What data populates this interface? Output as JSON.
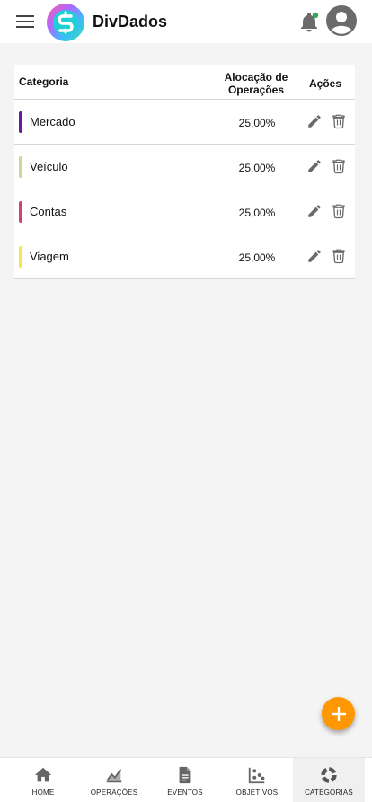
{
  "app": {
    "title": "DivDados"
  },
  "header": {
    "menu_icon": "menu-icon",
    "bell_icon": "notifications-icon",
    "account_icon": "account-circle-icon",
    "notification_dot_color": "#34a853"
  },
  "table": {
    "headers": {
      "categoria": "Categoria",
      "alocacao": "Alocação de Operações",
      "acoes": "Ações"
    },
    "rows": [
      {
        "name": "Mercado",
        "color": "#6a1b9a",
        "allocation": "25,00%"
      },
      {
        "name": "Veículo",
        "color": "#d6d396",
        "allocation": "25,00%"
      },
      {
        "name": "Contas",
        "color": "#d7426d",
        "allocation": "25,00%"
      },
      {
        "name": "Viagem",
        "color": "#f5e64a",
        "allocation": "25,00%"
      }
    ]
  },
  "fab": {
    "icon": "add-icon",
    "color": "#ff9800"
  },
  "bottom_nav": {
    "items": [
      {
        "label": "HOME",
        "icon": "home-icon"
      },
      {
        "label": "OPERAÇÕES",
        "icon": "chart-icon"
      },
      {
        "label": "EVENTOS",
        "icon": "document-icon"
      },
      {
        "label": "OBJETIVOS",
        "icon": "scatter-icon"
      },
      {
        "label": "CATEGORIAS",
        "icon": "donut-icon"
      }
    ],
    "active": "CATEGORIAS"
  }
}
